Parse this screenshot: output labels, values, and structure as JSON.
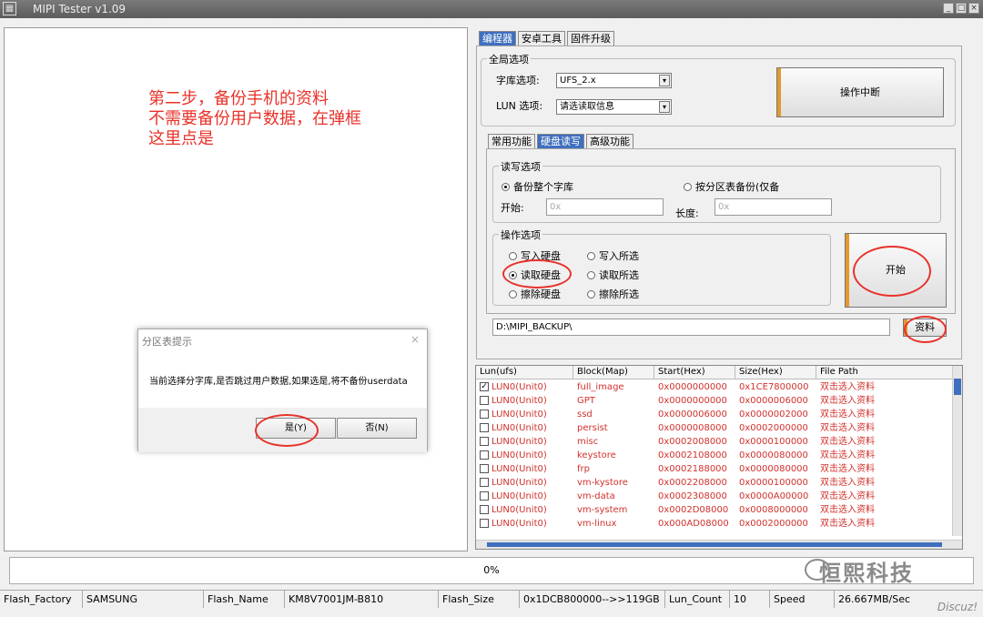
{
  "window": {
    "title": "MIPI Tester v1.09",
    "app_icon": "app-icon",
    "buttons": [
      "_",
      "□",
      "×"
    ]
  },
  "instructions": {
    "line1": "第二步，备份手机的资料",
    "line2": "不需要备份用户数据，在弹框",
    "line3": "这里点是"
  },
  "dialog": {
    "title": "分区表提示",
    "close": "×",
    "message": "当前选择分字库,是否跳过用户数据,如果选是,将不备份userdata",
    "yes": "是(Y)",
    "no": "否(N)"
  },
  "main_tabs": [
    "编程器",
    "安卓工具",
    "固件升级"
  ],
  "global": {
    "group_label": "全局选项",
    "lib_label": "字库选项:",
    "lib_value": "UFS_2.x",
    "lun_label": "LUN 选项:",
    "lun_value": "请选读取信息",
    "abort_button": "操作中断"
  },
  "sub_tabs": [
    "常用功能",
    "硬盘读写",
    "高级功能"
  ],
  "rw": {
    "group_label": "读写选项",
    "opt_whole": "备份整个字库",
    "opt_partition": "按分区表备份(仅备",
    "start_label": "开始:",
    "start_placeholder": "0x",
    "length_label": "长度:",
    "length_placeholder": "0x"
  },
  "ops": {
    "group_label": "操作选项",
    "write_disk": "写入硬盘",
    "write_selected": "写入所选",
    "read_disk": "读取硬盘",
    "read_selected": "读取所选",
    "erase_disk": "擦除硬盘",
    "erase_selected": "擦除所选",
    "start_button": "开始"
  },
  "path": {
    "value": "D:\\MIPI_BACKUP\\",
    "button": "资料"
  },
  "table": {
    "headers": [
      "Lun(ufs)",
      "Block(Map)",
      "Start(Hex)",
      "Size(Hex)",
      "File Path"
    ],
    "rows": [
      {
        "checked": "✓",
        "lun": "LUN0(Unit0)",
        "block": "full_image",
        "start": "0x0000000000",
        "size": "0x1CE7800000",
        "path": "双击选入资料"
      },
      {
        "checked": "",
        "lun": "LUN0(Unit0)",
        "block": "GPT",
        "start": "0x0000000000",
        "size": "0x0000006000",
        "path": "双击选入资料"
      },
      {
        "checked": "",
        "lun": "LUN0(Unit0)",
        "block": "ssd",
        "start": "0x0000006000",
        "size": "0x0000002000",
        "path": "双击选入资料"
      },
      {
        "checked": "",
        "lun": "LUN0(Unit0)",
        "block": "persist",
        "start": "0x0000008000",
        "size": "0x0002000000",
        "path": "双击选入资料"
      },
      {
        "checked": "",
        "lun": "LUN0(Unit0)",
        "block": "misc",
        "start": "0x0002008000",
        "size": "0x0000100000",
        "path": "双击选入资料"
      },
      {
        "checked": "",
        "lun": "LUN0(Unit0)",
        "block": "keystore",
        "start": "0x0002108000",
        "size": "0x0000080000",
        "path": "双击选入资料"
      },
      {
        "checked": "",
        "lun": "LUN0(Unit0)",
        "block": "frp",
        "start": "0x0002188000",
        "size": "0x0000080000",
        "path": "双击选入资料"
      },
      {
        "checked": "",
        "lun": "LUN0(Unit0)",
        "block": "vm-kystore",
        "start": "0x0002208000",
        "size": "0x0000100000",
        "path": "双击选入资料"
      },
      {
        "checked": "",
        "lun": "LUN0(Unit0)",
        "block": "vm-data",
        "start": "0x0002308000",
        "size": "0x0000A00000",
        "path": "双击选入资料"
      },
      {
        "checked": "",
        "lun": "LUN0(Unit0)",
        "block": "vm-system",
        "start": "0x0002D08000",
        "size": "0x0008000000",
        "path": "双击选入资料"
      },
      {
        "checked": "",
        "lun": "LUN0(Unit0)",
        "block": "vm-linux",
        "start": "0x000AD08000",
        "size": "0x0002000000",
        "path": "双击选入资料"
      }
    ]
  },
  "progress": {
    "text": "0%",
    "value": 0
  },
  "watermark": "恒熙科技",
  "status": {
    "flash_factory_label": "Flash_Factory",
    "flash_factory": "SAMSUNG",
    "flash_name_label": "Flash_Name",
    "flash_name": "KM8V7001JM-B810",
    "flash_size_label": "Flash_Size",
    "flash_size": "0x1DCB800000-->>119GB",
    "lun_count_label": "Lun_Count",
    "lun_count": "10",
    "speed_label": "Speed",
    "speed": "26.667MB/Sec"
  },
  "discuz": "Discuz!",
  "colors": {
    "accent": "#3f6fbf",
    "annotation": "#e8322a",
    "row_text": "#d0322d",
    "btn_stripe": "#e39a2b"
  }
}
